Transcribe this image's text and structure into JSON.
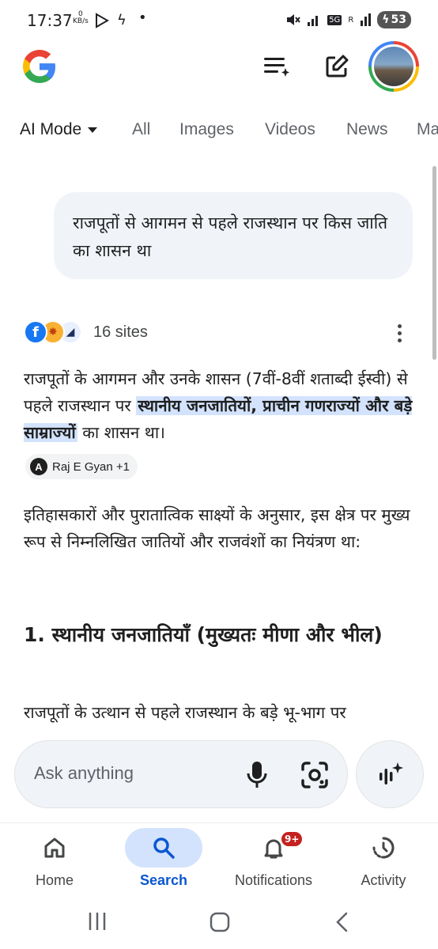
{
  "status_bar": {
    "time": "17:37",
    "net_speed_value": "0",
    "net_speed_unit": "KB/s",
    "network_label": "5G",
    "roaming_label": "R",
    "battery": "53"
  },
  "header": {
    "logo": "google-g-logo",
    "icons": [
      "history-sparkle-icon",
      "new-chat-edit-icon",
      "profile-avatar"
    ]
  },
  "tabs": [
    {
      "label": "AI Mode",
      "active": true
    },
    {
      "label": "All"
    },
    {
      "label": "Images"
    },
    {
      "label": "Videos"
    },
    {
      "label": "News"
    },
    {
      "label": "Ma"
    }
  ],
  "query": "राजपूतों से आगमन से पहले राजस्थान पर किस जाति का शासन था",
  "sources": {
    "count_label": "16 sites",
    "icons": [
      "facebook-icon",
      "orange-site-icon",
      "book-site-icon"
    ]
  },
  "answer": {
    "intro_before": "राजपूतों के आगमन और उनके शासन (7वीं-8वीं शताब्दी ईस्वी) से पहले राजस्थान पर ",
    "intro_highlight": "स्थानीय जनजातियों, प्राचीन गणराज्यों और बड़े साम्राज्यों",
    "intro_after": " का शासन था।",
    "citation_chip": "Raj E Gyan +1",
    "citation_letter": "A",
    "para2": "इतिहासकारों और पुरातात्विक साक्ष्यों के अनुसार, इस क्षेत्र पर मुख्य रूप से निम्नलिखित जातियों और राजवंशों का नियंत्रण था:",
    "heading1": "1. स्थानीय जनजातियाँ (मुख्यतः मीणा और भील)",
    "para3": "राजपूतों के उत्थान से पहले राजस्थान के बड़े भू-भाग पर"
  },
  "input": {
    "placeholder": "Ask anything"
  },
  "bottom_nav": [
    {
      "label": "Home",
      "icon": "home-icon"
    },
    {
      "label": "Search",
      "icon": "search-icon",
      "active": true
    },
    {
      "label": "Notifications",
      "icon": "bell-icon",
      "badge": "9+"
    },
    {
      "label": "Activity",
      "icon": "activity-clock-icon"
    }
  ],
  "colors": {
    "accent": "#0b57d0",
    "highlight": "#d3e3fd",
    "bubble": "#f0f4f9",
    "badge": "#c5221f"
  }
}
